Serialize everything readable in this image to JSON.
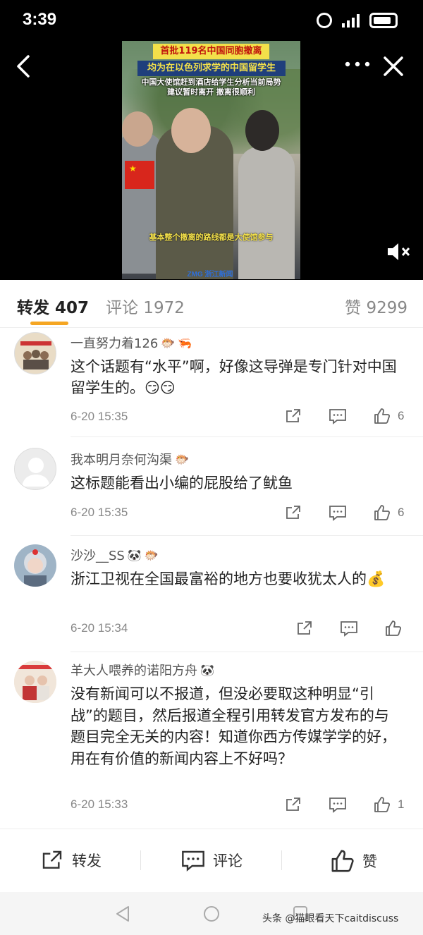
{
  "status_bar": {
    "time": "3:39"
  },
  "video": {
    "caption_line1": "首批119名中国同胞撤离",
    "caption_line2": "均为在以色列求学的中国留学生",
    "caption_sub1": "中国大使馆赶到酒店给学生分析当前局势",
    "caption_sub2": "建议暂时离开 撤离很顺利",
    "caption_bottom": "基本整个撤离的路线都是大使馆参与",
    "logo_text": "ZMG  浙江新闻"
  },
  "tabs": {
    "repost": "转发 407",
    "comment": "评论 1972",
    "like": "赞 9299"
  },
  "comments": [
    {
      "name": "一直努力着126",
      "text": "这个话题有“水平”啊，好像这导弹是专门针对中国留学生的。😏😏",
      "time": "6-20 15:35",
      "likes": "6"
    },
    {
      "name": "我本明月奈何沟渠",
      "text": "这标题能看出小编的屁股给了鱿鱼",
      "time": "6-20 15:35",
      "likes": "6"
    },
    {
      "name": "沙沙__SS",
      "text": "浙江卫视在全国最富裕的地方也要收犹太人的💰",
      "time": "6-20 15:34",
      "likes": ""
    },
    {
      "name": "羊大人喂养的诺阳方舟",
      "text": "没有新闻可以不报道，但没必要取这种明显“引战”的题目，然后报道全程引用转发官方发布的与题目完全无关的内容！知道你西方传媒学学的好，用在有价值的新闻内容上不好吗？",
      "time": "6-20 15:33",
      "likes": "1"
    }
  ],
  "bottom_bar": {
    "repost": "转发",
    "comment": "评论",
    "like": "赞"
  },
  "watermark": "头条 @猫眼看天下caitdiscuss",
  "colors": {
    "accent": "#f5a623",
    "text_primary": "#222222",
    "text_secondary": "#888888"
  }
}
